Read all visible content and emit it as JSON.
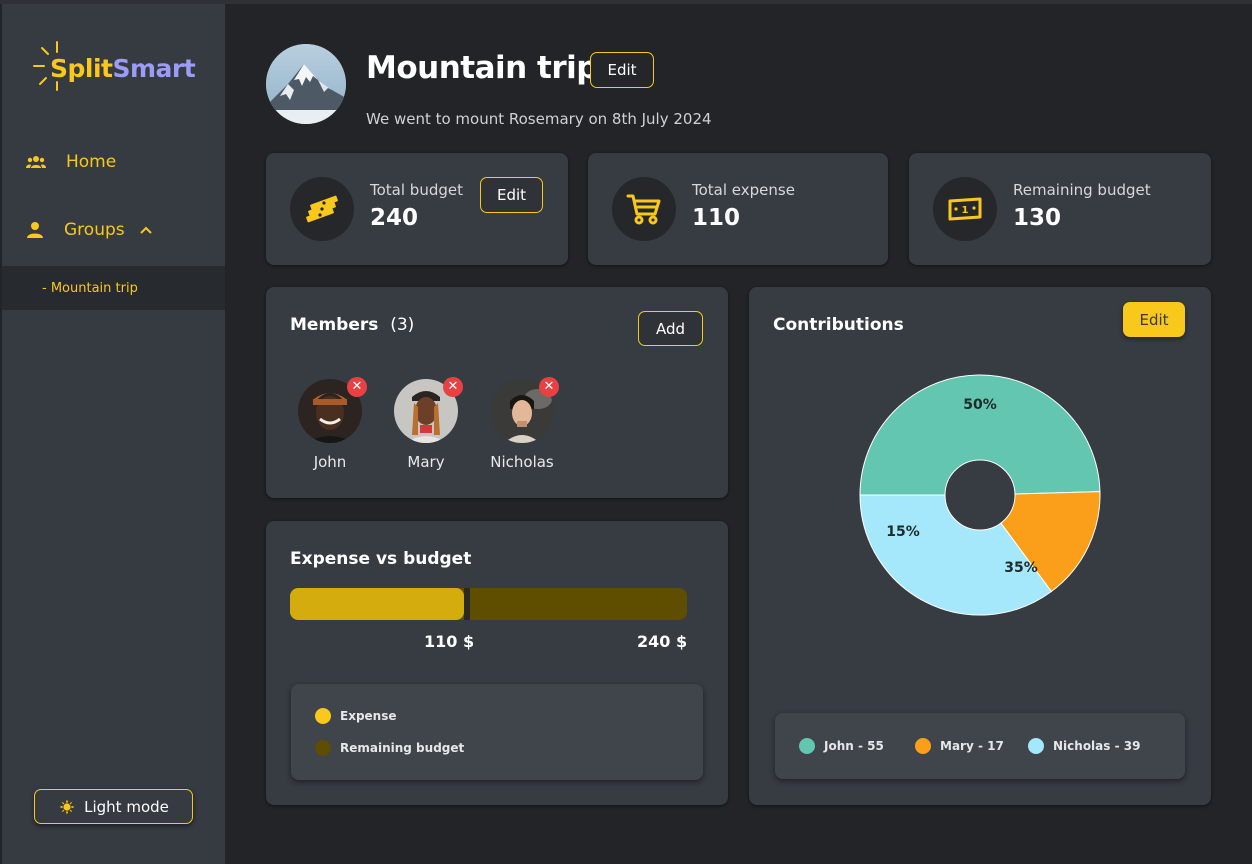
{
  "app": {
    "logo_part1": "Split",
    "logo_part2": "Smart"
  },
  "sidebar": {
    "items": [
      {
        "label": "Home",
        "icon": "group-icon"
      },
      {
        "label": "Groups",
        "icon": "person-icon",
        "expanded": true
      }
    ],
    "sub_items": [
      {
        "label": "- Mountain trip"
      }
    ],
    "light_mode_label": "Light mode"
  },
  "header": {
    "title": "Mountain trip",
    "edit_label": "Edit",
    "description": "We went to mount Rosemary on 8th July 2024"
  },
  "stats": {
    "total_budget": {
      "label": "Total budget",
      "value": "240",
      "edit_label": "Edit"
    },
    "total_expense": {
      "label": "Total expense",
      "value": "110"
    },
    "remaining_budget": {
      "label": "Remaining budget",
      "value": "130"
    }
  },
  "members": {
    "title": "Members",
    "count": "(3)",
    "add_label": "Add",
    "list": [
      {
        "name": "John"
      },
      {
        "name": "Mary"
      },
      {
        "name": "Nicholas"
      }
    ]
  },
  "expense_vs_budget": {
    "title": "Expense vs budget",
    "expense": 110,
    "budget": 240,
    "expense_text": "110 $",
    "budget_text": "240 $",
    "legend": [
      {
        "label": "Expense",
        "color": "#f8c81c"
      },
      {
        "label": "Remaining budget",
        "color": "#5f4d00"
      }
    ]
  },
  "contributions": {
    "title": "Contributions",
    "edit_label": "Edit",
    "legend": [
      {
        "label": "John - 55",
        "color": "#62c6b0"
      },
      {
        "label": "Mary - 17",
        "color": "#fb9f1a"
      },
      {
        "label": "Nicholas - 39",
        "color": "#a6e8fb"
      }
    ]
  },
  "chart_data": {
    "type": "pie",
    "title": "Contributions",
    "categories": [
      "John",
      "Mary",
      "Nicholas"
    ],
    "values": [
      55,
      17,
      39
    ],
    "labels": [
      "50%",
      "15%",
      "35%"
    ],
    "colors": [
      "#62c6b0",
      "#fb9f1a",
      "#a6e8fb"
    ],
    "legend": "bottom"
  },
  "colors": {
    "accent": "#f8c81c",
    "sidebar_bg": "#363a41",
    "page_bg": "#222428",
    "card_bg": "#373b42",
    "danger": "#e74141"
  }
}
